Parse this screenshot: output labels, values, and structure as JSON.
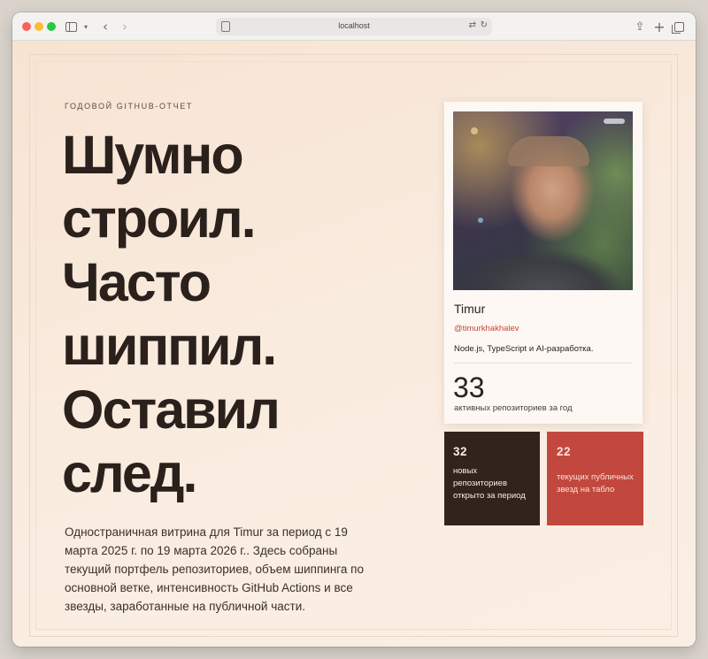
{
  "browser": {
    "url": "localhost",
    "colors": {
      "close": "#ff5f57",
      "minimize": "#febc2e",
      "zoom": "#28c840"
    }
  },
  "page": {
    "eyebrow": "ГОДОВОЙ GITHUB-ОТЧЕТ",
    "headline_lines": [
      "Шумно",
      "строил.",
      "Часто",
      "шиппил.",
      "Оставил",
      "след."
    ],
    "lead": "Одностраничная витрина для Timur за период с 19 марта 2025 г. по 19 марта 2026 г.. Здесь собраны текущий портфель репозиториев, объем шиппинга по основной ветке, интенсивность GitHub Actions и все звезды, заработанные на публичной части."
  },
  "profile": {
    "name": "Timur",
    "handle": "@timurkhakhalev",
    "bio": "Node.js, TypeScript и AI-разработка.",
    "active_repos": "33",
    "active_repos_label": "активных репозиториев за год"
  },
  "stats": {
    "new_repos": "32",
    "new_repos_label": "новых репозиториев открыто за период",
    "stars": "22",
    "stars_label": "текущих публичных звезд на табло"
  },
  "colors": {
    "accent": "#c2483d",
    "dark": "#33231d",
    "text": "#2b211c",
    "background": "#f8e8da"
  }
}
